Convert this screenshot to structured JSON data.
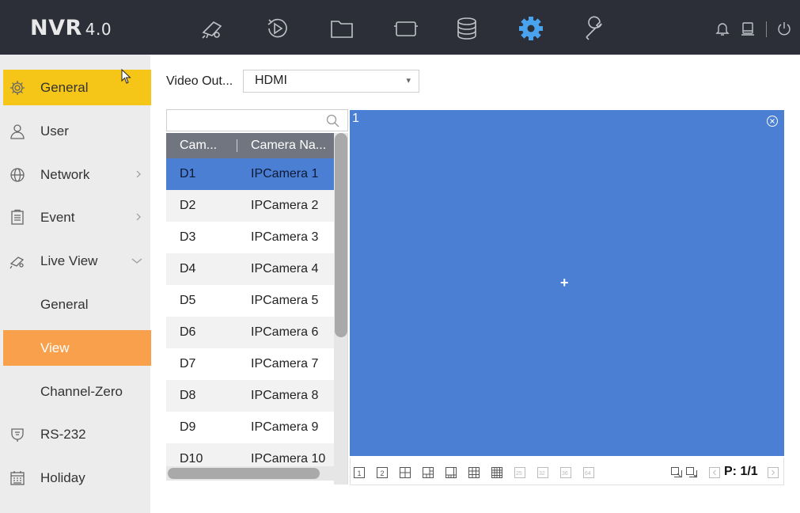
{
  "app": {
    "logo_main": "NVR",
    "logo_version": "4.0"
  },
  "topnav": [
    {
      "icon": "camera-live-view-icon"
    },
    {
      "icon": "playback-icon"
    },
    {
      "icon": "file-management-icon"
    },
    {
      "icon": "smart-analysis-icon"
    },
    {
      "icon": "storage-icon"
    },
    {
      "icon": "gear-icon",
      "active": true
    },
    {
      "icon": "maintenance-wrench-icon"
    }
  ],
  "topright": [
    "bell-icon",
    "alarm-icon",
    "power-icon"
  ],
  "sidebar": {
    "items": [
      {
        "label": "General",
        "icon": "gear-icon",
        "state": "active-main"
      },
      {
        "label": "User",
        "icon": "user-icon"
      },
      {
        "label": "Network",
        "icon": "globe-icon",
        "arrow": "right"
      },
      {
        "label": "Event",
        "icon": "event-icon",
        "arrow": "right"
      },
      {
        "label": "Live View",
        "icon": "live-view-icon",
        "arrow": "down"
      },
      {
        "label": "General",
        "sub": true
      },
      {
        "label": "View",
        "sub": true,
        "state": "active-sub"
      },
      {
        "label": "Channel-Zero",
        "sub": true
      },
      {
        "label": "RS-232",
        "icon": "rs232-icon"
      },
      {
        "label": "Holiday",
        "icon": "calendar-icon"
      }
    ]
  },
  "video_output": {
    "label": "Video Out...",
    "value": "HDMI"
  },
  "search": {
    "placeholder": ""
  },
  "camera_table": {
    "headers": [
      "Cam...",
      "Camera Na..."
    ],
    "rows": [
      {
        "id": "D1",
        "name": "IPCamera 1",
        "selected": true
      },
      {
        "id": "D2",
        "name": "IPCamera 2"
      },
      {
        "id": "D3",
        "name": "IPCamera 3"
      },
      {
        "id": "D4",
        "name": "IPCamera 4"
      },
      {
        "id": "D5",
        "name": "IPCamera 5"
      },
      {
        "id": "D6",
        "name": "IPCamera 6"
      },
      {
        "id": "D7",
        "name": "IPCamera 7"
      },
      {
        "id": "D8",
        "name": "IPCamera 8"
      },
      {
        "id": "D9",
        "name": "IPCamera 9"
      },
      {
        "id": "D10",
        "name": "IPCamera 10"
      }
    ]
  },
  "preview": {
    "window_number": "1",
    "add_symbol": "+"
  },
  "layout_bar": {
    "layouts": [
      "1",
      "2",
      "4",
      "6",
      "8",
      "9",
      "16",
      "25",
      "32",
      "36",
      "64"
    ],
    "page": "P: 1/1"
  },
  "colors": {
    "topbar": "#2c2f38",
    "accent_yellow": "#f5c518",
    "accent_orange": "#f9a04c",
    "selection_blue": "#4a7fd4",
    "header_gray": "#707580"
  }
}
